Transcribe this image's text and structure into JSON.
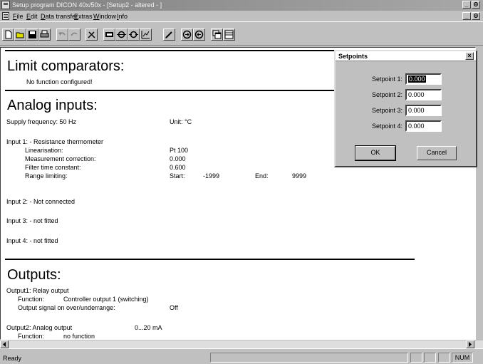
{
  "window": {
    "title": "Setup program DICON 40x/50x - [Setup2 - altered - ]",
    "caption_buttons": [
      "_",
      "Θ"
    ]
  },
  "menu": [
    "File",
    "Edit",
    "Data transfer",
    "Extras",
    "Window",
    "Info"
  ],
  "document": {
    "limit": {
      "heading": "Limit comparators:",
      "note": "No function configured!"
    },
    "analog": {
      "heading": "Analog inputs:",
      "supply": "Supply frequency: 50 Hz",
      "unit": "Unit: °C",
      "input1": {
        "title": "Input 1: - Resistance thermometer",
        "rows": [
          {
            "label": "Linearisation:",
            "value": "Pt 100"
          },
          {
            "label": "Measurement correction:",
            "value": "0.000"
          },
          {
            "label": "Filter time constant:",
            "value": "0.600"
          }
        ],
        "range_label": "Range limiting:",
        "start_label": "Start:",
        "start_value": "-1999",
        "end_label": "End:",
        "end_value": "9999"
      },
      "input2": "Input 2: - Not connected",
      "input3": "Input 3: - not fitted",
      "input4": "Input 4: - not fitted"
    },
    "outputs": {
      "heading": "Outputs:",
      "output1": "Output1: Relay output",
      "function_label": "Function:",
      "function_value": "Controller output 1 (switching)",
      "signal_label": "Output signal on over/underrange:",
      "signal_value": "Off",
      "output2": "Output2: Analog output",
      "output2_range": "0...20 mA",
      "function2_label": "Function:",
      "function2_value": "no function"
    }
  },
  "dialog": {
    "title": "Setpoints",
    "close": "×",
    "setpoints": [
      {
        "label": "Setpoint 1:",
        "value": "0.000"
      },
      {
        "label": "Setpoint 2:",
        "value": "0.000"
      },
      {
        "label": "Setpoint 3:",
        "value": "0.000"
      },
      {
        "label": "Setpoint 4:",
        "value": "0.000"
      }
    ],
    "ok": "OK",
    "cancel": "Cancel"
  },
  "statusbar": {
    "text": "Ready",
    "num": "NUM"
  }
}
